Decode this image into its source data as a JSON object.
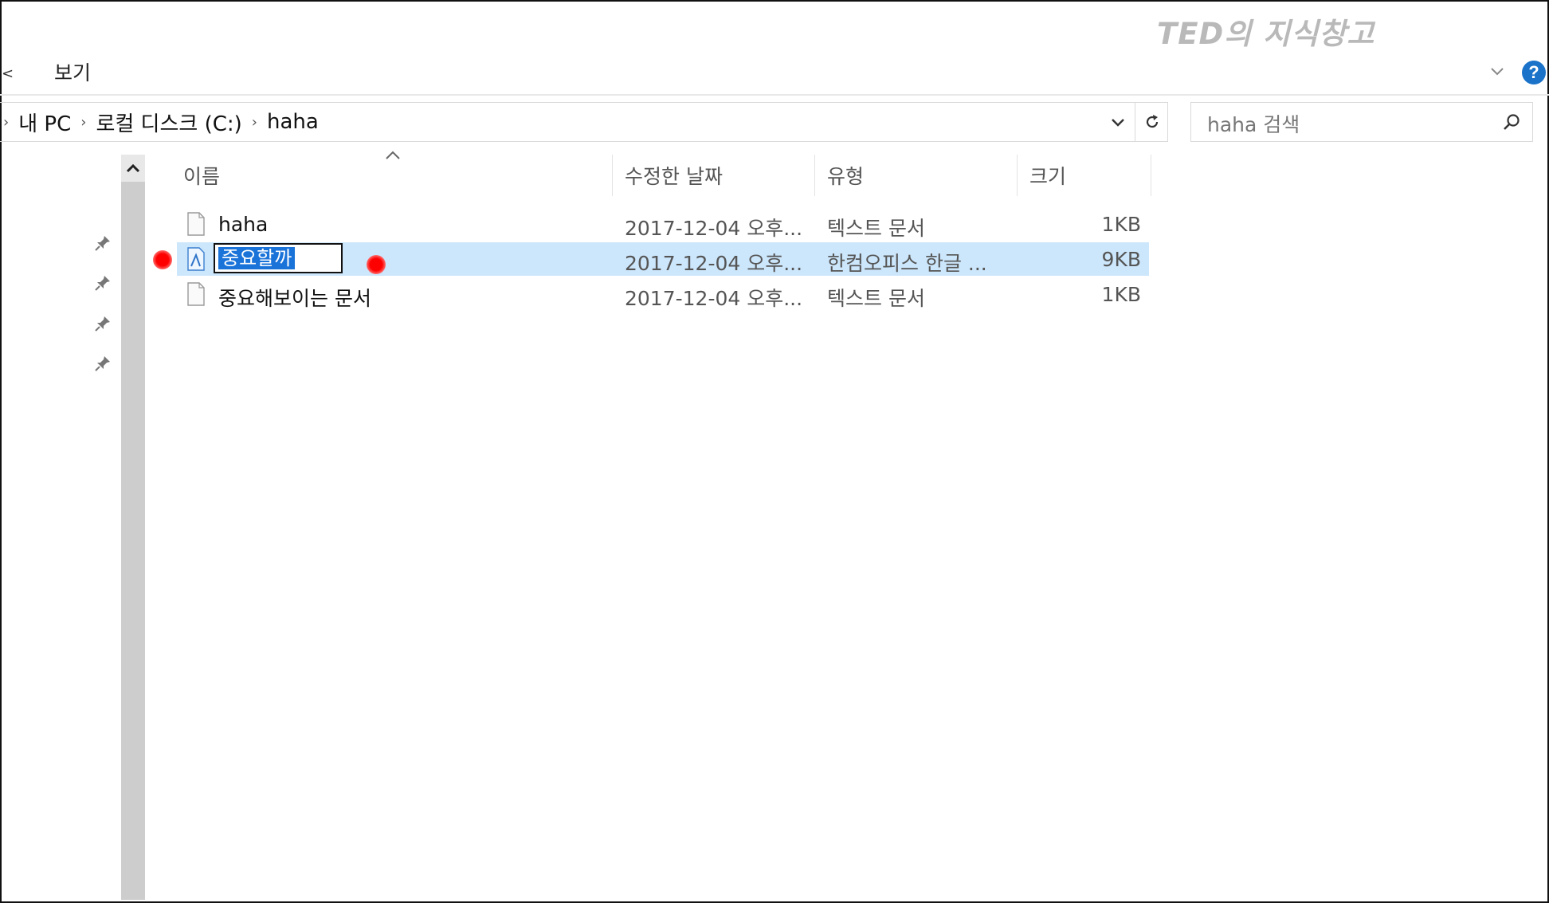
{
  "watermark": "TED의 지식창고",
  "ribbon": {
    "tab_view": "보기",
    "help_icon": "?"
  },
  "address": {
    "crumbs": [
      "내 PC",
      "로컬 디스크 (C:)",
      "haha"
    ]
  },
  "search": {
    "placeholder": "haha 검색"
  },
  "file_list": {
    "columns": {
      "name": "이름",
      "date": "수정한 날짜",
      "type": "유형",
      "size": "크기"
    },
    "rows": [
      {
        "name": "haha",
        "date": "2017-12-04 오후...",
        "type": "텍스트 문서",
        "size": "1KB",
        "icon": "text-file-icon"
      },
      {
        "name": "중요할까",
        "date": "2017-12-04 오후...",
        "type": "한컴오피스 한글 ...",
        "size": "9KB",
        "icon": "hwp-file-icon",
        "selected": true,
        "renaming": true
      },
      {
        "name": "중요해보이는 문서",
        "date": "2017-12-04 오후...",
        "type": "텍스트 문서",
        "size": "1KB",
        "icon": "text-file-icon"
      }
    ]
  },
  "colors": {
    "selection": "#cce6fb",
    "rename_highlight": "#1a73d9",
    "help_blue": "#1a73c9",
    "marker_red": "#ff0000"
  }
}
